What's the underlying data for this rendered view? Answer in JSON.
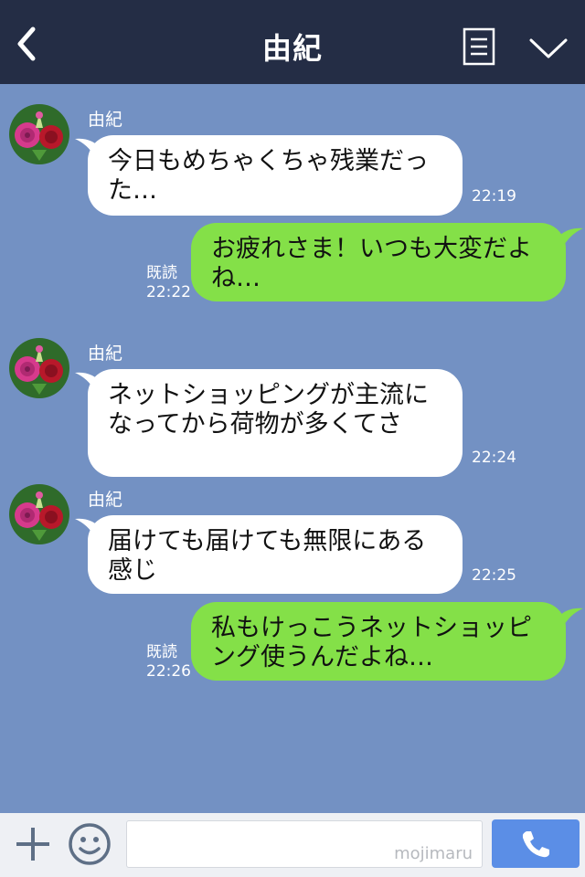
{
  "header": {
    "title": "由紀"
  },
  "messages": [
    {
      "sender": "由紀",
      "text": "今日もめちゃくちゃ残業だった…",
      "time": "22:19"
    },
    {
      "status": "既読",
      "text": "お疲れさま！いつも大変だよね…",
      "time": "22:22"
    },
    {
      "sender": "由紀",
      "text": "ネットショッピングが主流になってから荷物が多くてさ",
      "time": "22:24"
    },
    {
      "sender": "由紀",
      "text": "届けても届けても無限にある感じ",
      "time": "22:25"
    },
    {
      "status": "既読",
      "text": "私もけっこうネットショッピング使うんだよね…",
      "time": "22:26"
    }
  ],
  "input": {
    "placeholder": "",
    "watermark": "mojimaru"
  },
  "colors": {
    "header_bg": "#242d45",
    "chat_bg": "#7391c3",
    "incoming_bubble": "#ffffff",
    "outgoing_bubble": "#84e048",
    "send_button": "#5b8ee6"
  },
  "icons": [
    "back-icon",
    "menu-icon",
    "chevron-down-icon",
    "plus-icon",
    "smile-icon",
    "phone-icon",
    "avatar-rose"
  ]
}
